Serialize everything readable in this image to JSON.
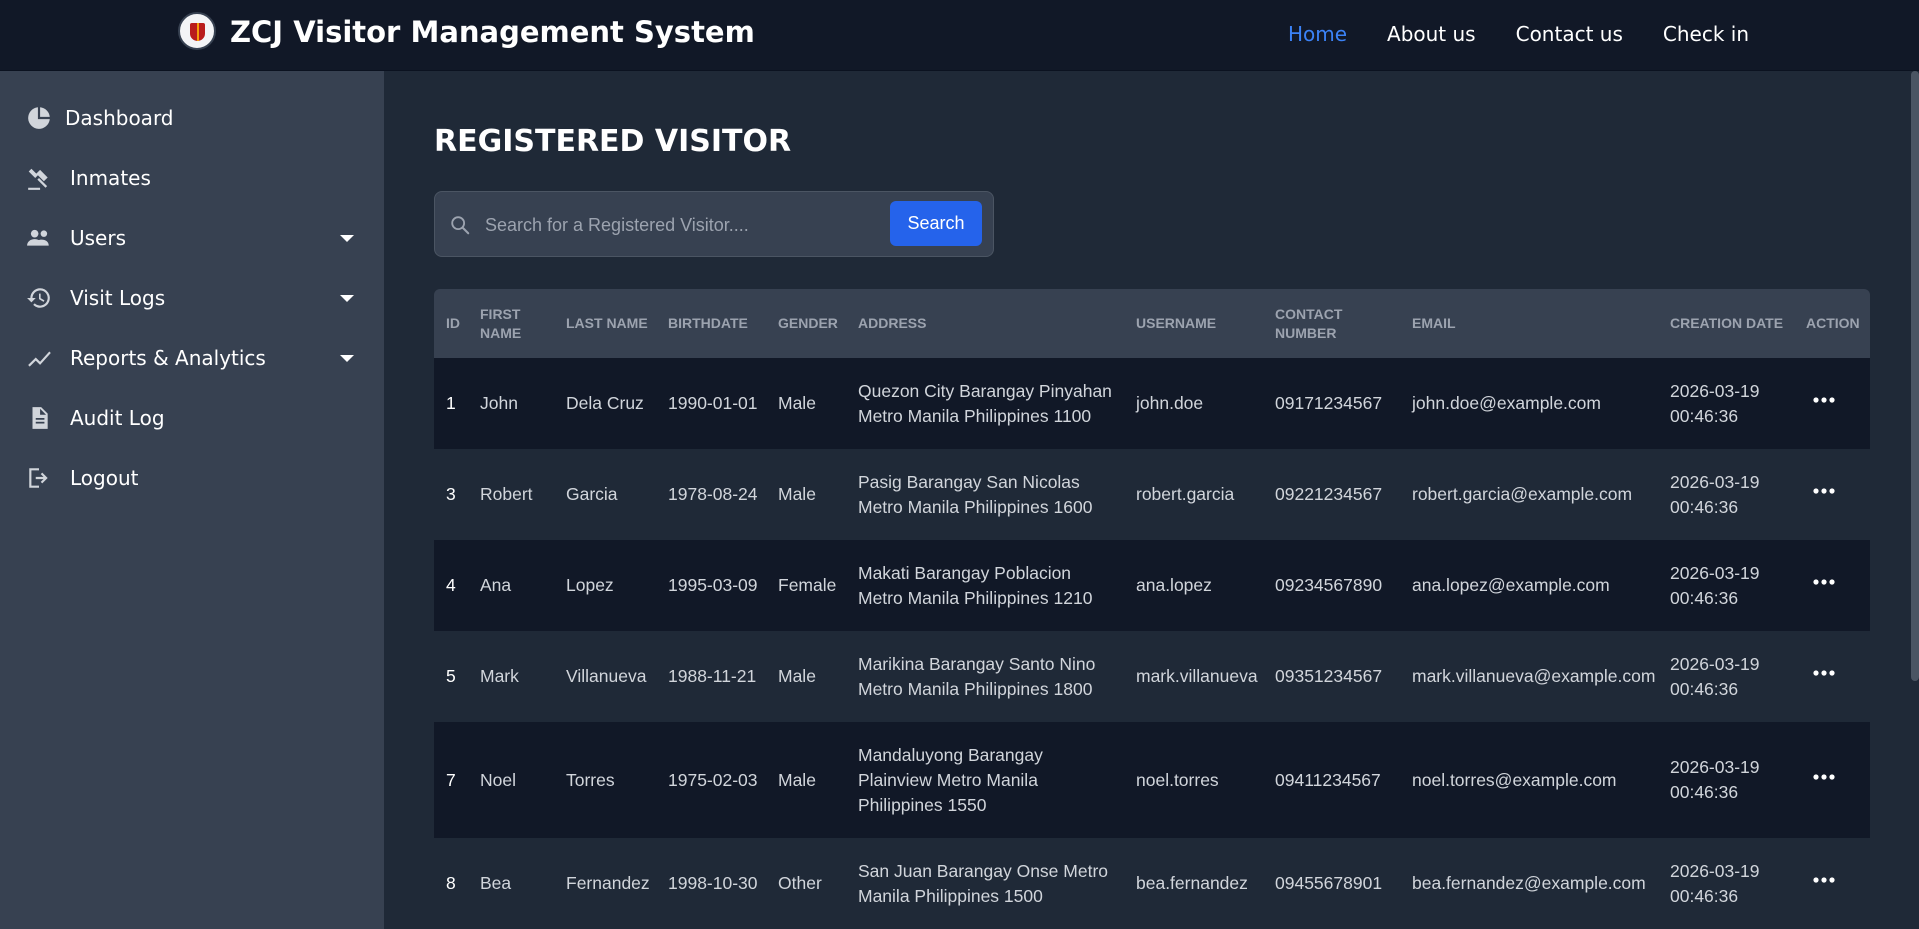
{
  "header": {
    "title": "ZCJ Visitor Management System",
    "logo_icon": "seal-logo-icon",
    "nav": [
      {
        "label": "Home",
        "active": true
      },
      {
        "label": "About us",
        "active": false
      },
      {
        "label": "Contact us",
        "active": false
      },
      {
        "label": "Check in",
        "active": false
      }
    ]
  },
  "sidebar": {
    "items": [
      {
        "label": "Dashboard",
        "icon": "pie-chart-icon",
        "expandable": false
      },
      {
        "label": "Inmates",
        "icon": "gavel-icon",
        "expandable": false
      },
      {
        "label": "Users",
        "icon": "users-icon",
        "expandable": true
      },
      {
        "label": "Visit Logs",
        "icon": "history-icon",
        "expandable": true
      },
      {
        "label": "Reports & Analytics",
        "icon": "trend-line-icon",
        "expandable": true
      },
      {
        "label": "Audit Log",
        "icon": "document-icon",
        "expandable": false
      },
      {
        "label": "Logout",
        "icon": "logout-icon",
        "expandable": false
      }
    ]
  },
  "main": {
    "title": "REGISTERED VISITOR",
    "search": {
      "placeholder": "Search for a Registered Visitor....",
      "button_label": "Search"
    },
    "table": {
      "columns": [
        "ID",
        "FIRST NAME",
        "LAST NAME",
        "BIRTHDATE",
        "GENDER",
        "ADDRESS",
        "USERNAME",
        "CONTACT NUMBER",
        "EMAIL",
        "CREATION DATE",
        "ACTION"
      ],
      "rows": [
        {
          "id": "1",
          "first": "John",
          "last": "Dela Cruz",
          "birthdate": "1990-01-01",
          "gender": "Male",
          "address": "Quezon City Barangay Pinyahan Metro Manila Philippines 1100",
          "username": "john.doe",
          "contact": "09171234567",
          "email": "john.doe@example.com",
          "created": "2026-03-19 00:46:36"
        },
        {
          "id": "3",
          "first": "Robert",
          "last": "Garcia",
          "birthdate": "1978-08-24",
          "gender": "Male",
          "address": "Pasig Barangay San Nicolas Metro Manila Philippines 1600",
          "username": "robert.garcia",
          "contact": "09221234567",
          "email": "robert.garcia@example.com",
          "created": "2026-03-19 00:46:36"
        },
        {
          "id": "4",
          "first": "Ana",
          "last": "Lopez",
          "birthdate": "1995-03-09",
          "gender": "Female",
          "address": "Makati Barangay Poblacion Metro Manila Philippines 1210",
          "username": "ana.lopez",
          "contact": "09234567890",
          "email": "ana.lopez@example.com",
          "created": "2026-03-19 00:46:36"
        },
        {
          "id": "5",
          "first": "Mark",
          "last": "Villanueva",
          "birthdate": "1988-11-21",
          "gender": "Male",
          "address": "Marikina Barangay Santo Nino Metro Manila Philippines 1800",
          "username": "mark.villanueva",
          "contact": "09351234567",
          "email": "mark.villanueva@example.com",
          "created": "2026-03-19 00:46:36"
        },
        {
          "id": "7",
          "first": "Noel",
          "last": "Torres",
          "birthdate": "1975-02-03",
          "gender": "Male",
          "address": "Mandaluyong Barangay Plainview Metro Manila Philippines 1550",
          "username": "noel.torres",
          "contact": "09411234567",
          "email": "noel.torres@example.com",
          "created": "2026-03-19 00:46:36"
        },
        {
          "id": "8",
          "first": "Bea",
          "last": "Fernandez",
          "birthdate": "1998-10-30",
          "gender": "Other",
          "address": "San Juan Barangay Onse Metro Manila Philippines 1500",
          "username": "bea.fernandez",
          "contact": "09455678901",
          "email": "bea.fernandez@example.com",
          "created": "2026-03-19 00:46:36"
        }
      ],
      "action_icon": "ellipsis-icon"
    }
  },
  "colors": {
    "accent": "#2563eb",
    "nav_active": "#3b82f6",
    "topbar_bg": "#111827",
    "sidebar_bg": "#374151",
    "main_bg": "#1f2937"
  }
}
